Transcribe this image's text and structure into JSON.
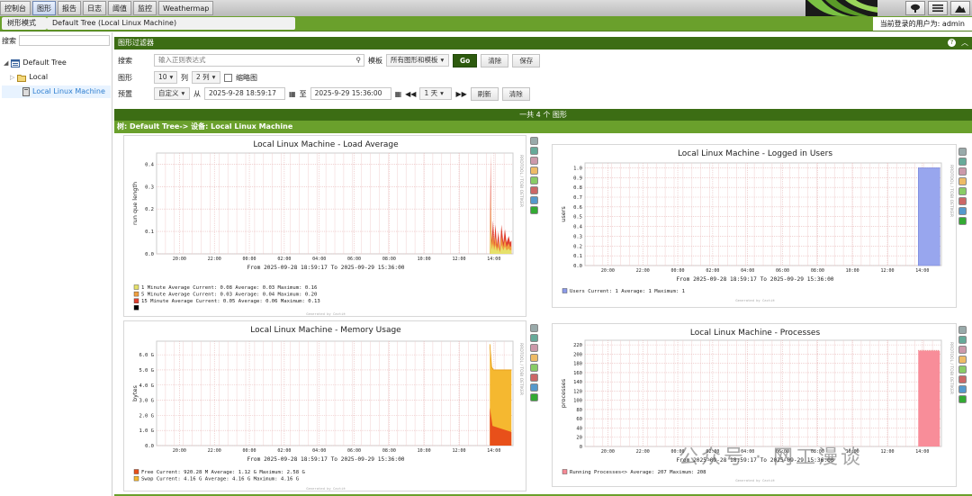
{
  "top_tabs": [
    "控制台",
    "图形",
    "报告",
    "日志",
    "阈值",
    "监控",
    "Weathermap"
  ],
  "active_tab": 1,
  "nav": {
    "mode": "树形模式",
    "path": "Default Tree (Local Linux Machine)",
    "user_label": "当前登录的用户为: admin"
  },
  "sidebar": {
    "search_label": "搜索",
    "tree": [
      {
        "label": "Default Tree"
      },
      {
        "label": "Local"
      },
      {
        "label": "Local Linux Machine"
      }
    ]
  },
  "filter": {
    "header": "图形过滤器",
    "search_label": "搜索",
    "search_placeholder": "输入正则表达式",
    "template_label": "模板",
    "template_value": "所有图形和模板",
    "go": "Go",
    "clear": "清除",
    "save": "保存",
    "graphs_label": "图形",
    "graphs_value": "10",
    "cols_label": "列",
    "cols_value": "2 列",
    "thumb_label": "缩略图",
    "preset_label": "预置",
    "preset_value": "自定义",
    "from_label": "从",
    "from_value": "2025-9-28 18:59:17",
    "to_label": "至",
    "to_value": "2025-9-29 15:36:00",
    "span_value": "1 天",
    "refresh": "刷新",
    "clear2": "清除"
  },
  "count_text": "一共 4 个 图形",
  "tree_path": "树: Default Tree-> 设备: Local Linux Machine",
  "time_range": "From 2025-09-28 18:59:17 To 2025-09-29 15:36:00",
  "generated": "Generated by Cacti®",
  "side_label": "RRDTOOL / TOBI OETIKER",
  "x_ticks": [
    "20:00",
    "22:00",
    "00:00",
    "02:00",
    "04:00",
    "06:00",
    "08:00",
    "10:00",
    "12:00",
    "14:00"
  ],
  "chart_data": [
    {
      "type": "area",
      "title": "Local Linux Machine - Load Average",
      "ylabel": "run que length",
      "y_ticks": [
        "0.4",
        "0.3",
        "0.2",
        "0.1",
        "0.0"
      ],
      "ylim": [
        0,
        0.45
      ],
      "legend": [
        {
          "color": "#e6e16b",
          "text": "1 Minute Average    Current:    0.08   Average:    0.03   Maximum:    0.16"
        },
        {
          "color": "#f0a040",
          "text": "5 Minute Average    Current:    0.03   Average:    0.04   Maximum:    0.20"
        },
        {
          "color": "#e04030",
          "text": "15 Minute Average   Current:    0.05   Average:    0.06   Maximum:    0.13"
        },
        {
          "color": "#000000",
          "text": ""
        }
      ]
    },
    {
      "type": "area",
      "title": "Local Linux Machine - Logged in Users",
      "ylabel": "users",
      "y_ticks": [
        "1.0",
        "0.9",
        "0.8",
        "0.7",
        "0.6",
        "0.5",
        "0.4",
        "0.3",
        "0.2",
        "0.1",
        "0.0"
      ],
      "ylim": [
        0,
        1.05
      ],
      "legend": [
        {
          "color": "#8d9be8",
          "text": "Users   Current:       1   Average:       1   Maximum:       1"
        }
      ],
      "series": [
        {
          "name": "Users",
          "value": 1
        }
      ]
    },
    {
      "type": "area",
      "title": "Local Linux Machine - Memory Usage",
      "ylabel": "bytes",
      "y_ticks": [
        "6.0 G",
        "5.0 G",
        "4.0 G",
        "3.0 G",
        "2.0 G",
        "1.0 G",
        "0.0"
      ],
      "ylim": [
        0,
        6.9
      ],
      "legend": [
        {
          "color": "#e8501a",
          "text": "Free   Current:   920.28 M   Average:     1.12 G   Maximum:     2.58 G"
        },
        {
          "color": "#f5b830",
          "text": "Swap   Current:     4.16 G   Average:     4.16 G   Maximum:     4.16 G"
        }
      ]
    },
    {
      "type": "area",
      "title": "Local Linux Machine - Processes",
      "ylabel": "processes",
      "y_ticks": [
        "220",
        "200",
        "180",
        "160",
        "140",
        "120",
        "100",
        "80",
        "60",
        "40",
        "20",
        "0"
      ],
      "ylim": [
        0,
        230
      ],
      "legend": [
        {
          "color": "#f58a96",
          "text": "Running Processes<>   Average:     207   Maximum:     208"
        }
      ],
      "series": [
        {
          "name": "Running Processes<>",
          "value": 207
        }
      ]
    }
  ],
  "watermark": "公众号 · 网工漫谈",
  "colors": {
    "green_dark": "#3c6d14",
    "green": "#6aa02c"
  }
}
